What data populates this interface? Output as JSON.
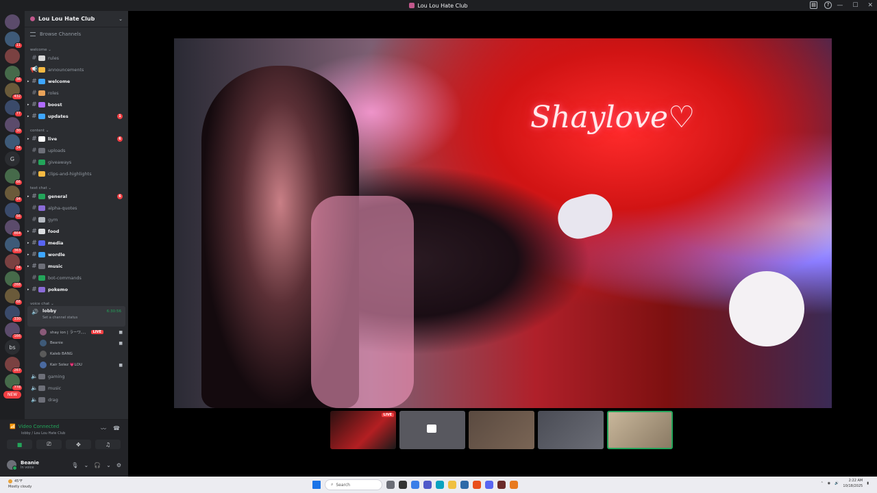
{
  "window": {
    "title": "Lou Lou Hate Club"
  },
  "servers": [
    {
      "badge": ""
    },
    {
      "badge": "11"
    },
    {
      "badge": ""
    },
    {
      "badge": "36"
    },
    {
      "badge": "432"
    },
    {
      "badge": "77"
    },
    {
      "badge": "30"
    },
    {
      "badge": "34"
    },
    {
      "label": "G",
      "badge": ""
    },
    {
      "badge": "66"
    },
    {
      "badge": "94"
    },
    {
      "badge": "56"
    },
    {
      "badge": "864"
    },
    {
      "badge": "363"
    },
    {
      "badge": "34"
    },
    {
      "badge": "268"
    },
    {
      "badge": "68"
    },
    {
      "badge": "330"
    },
    {
      "badge": "166"
    },
    {
      "label": "bs",
      "badge": ""
    },
    {
      "badge": "267"
    },
    {
      "badge": "778"
    }
  ],
  "servers_new_badge": "NEW",
  "sidebar": {
    "guild_name": "Lou Lou Hate Club",
    "browse_channels": "Browse Channels",
    "categories": [
      {
        "name": "welcome",
        "channels": [
          {
            "name": "rules",
            "bold": false,
            "caret": false,
            "emoji_color": "#d9d9d9"
          },
          {
            "name": "announcements",
            "bold": false,
            "caret": false,
            "emoji_color": "#f5b942",
            "type": "announce"
          },
          {
            "name": "welcome",
            "bold": true,
            "caret": true,
            "emoji_color": "#3ea6ff"
          },
          {
            "name": "roles",
            "bold": false,
            "caret": false,
            "emoji_color": "#e8a35a"
          },
          {
            "name": "boost",
            "bold": true,
            "caret": true,
            "emoji_color": "#b06bff"
          },
          {
            "name": "updates",
            "bold": true,
            "caret": true,
            "emoji_color": "#3ea6ff",
            "unread": "1"
          }
        ]
      },
      {
        "name": "content",
        "channels": [
          {
            "name": "live",
            "bold": true,
            "caret": true,
            "emoji_color": "#ffffff",
            "unread": "6"
          },
          {
            "name": "uploads",
            "bold": false,
            "caret": false,
            "emoji_color": "#6d6f78"
          },
          {
            "name": "giveaways",
            "bold": false,
            "caret": false,
            "emoji_color": "#23a55a"
          },
          {
            "name": "clips-and-highlights",
            "bold": false,
            "caret": false,
            "emoji_color": "#f5b942"
          }
        ]
      },
      {
        "name": "text chat",
        "channels": [
          {
            "name": "general",
            "bold": true,
            "caret": true,
            "emoji_color": "#23a55a",
            "unread": "6"
          },
          {
            "name": "alpha-quotes",
            "bold": false,
            "caret": false,
            "emoji_color": "#8a6bd6"
          },
          {
            "name": "gym",
            "bold": false,
            "caret": false,
            "emoji_color": "#b5bac1"
          },
          {
            "name": "food",
            "bold": true,
            "caret": true,
            "emoji_color": "#dbdee1"
          },
          {
            "name": "media",
            "bold": true,
            "caret": true,
            "emoji_color": "#5865f2"
          },
          {
            "name": "wordle",
            "bold": true,
            "caret": true,
            "emoji_color": "#3ea6ff"
          },
          {
            "name": "music",
            "bold": true,
            "caret": true,
            "emoji_color": "#6d6f78"
          },
          {
            "name": "bot-commands",
            "bold": false,
            "caret": false,
            "emoji_color": "#23a55a"
          },
          {
            "name": "pokemo",
            "bold": true,
            "caret": true,
            "emoji_color": "#8a6bd6"
          }
        ]
      }
    ],
    "voice_category": "voice chat",
    "voice_room": {
      "name": "lobby",
      "status": "Set a channel status",
      "time": "6:30:56"
    },
    "voice_users": [
      {
        "name": "shay ion | ラーワ、、、",
        "live": "LIVE",
        "cam": true
      },
      {
        "name": "Beanie",
        "live": "",
        "cam": true
      },
      {
        "name": "Kaleb BANG",
        "live": "",
        "cam": false
      },
      {
        "name": "Kair Solez 💗LOU",
        "live": "",
        "cam": true
      }
    ],
    "voice_channels": [
      "gaming",
      "music",
      "drag"
    ]
  },
  "voice_connected": {
    "title": "Video Connected",
    "sub": "lobby / Lou Lou Hate Club"
  },
  "user_panel": {
    "name": "Beanie",
    "status": "In voice"
  },
  "video": {
    "sign_text": "Shaylove♡"
  },
  "thumbnails": [
    {
      "live": "LIVE"
    },
    {
      "live": ""
    },
    {
      "live": ""
    },
    {
      "live": ""
    },
    {
      "live": ""
    }
  ],
  "taskbar": {
    "weather_temp": "45°F",
    "weather_desc": "Mostly cloudy",
    "search": "Search",
    "time": "2:22 AM",
    "date": "10/18/2025"
  }
}
